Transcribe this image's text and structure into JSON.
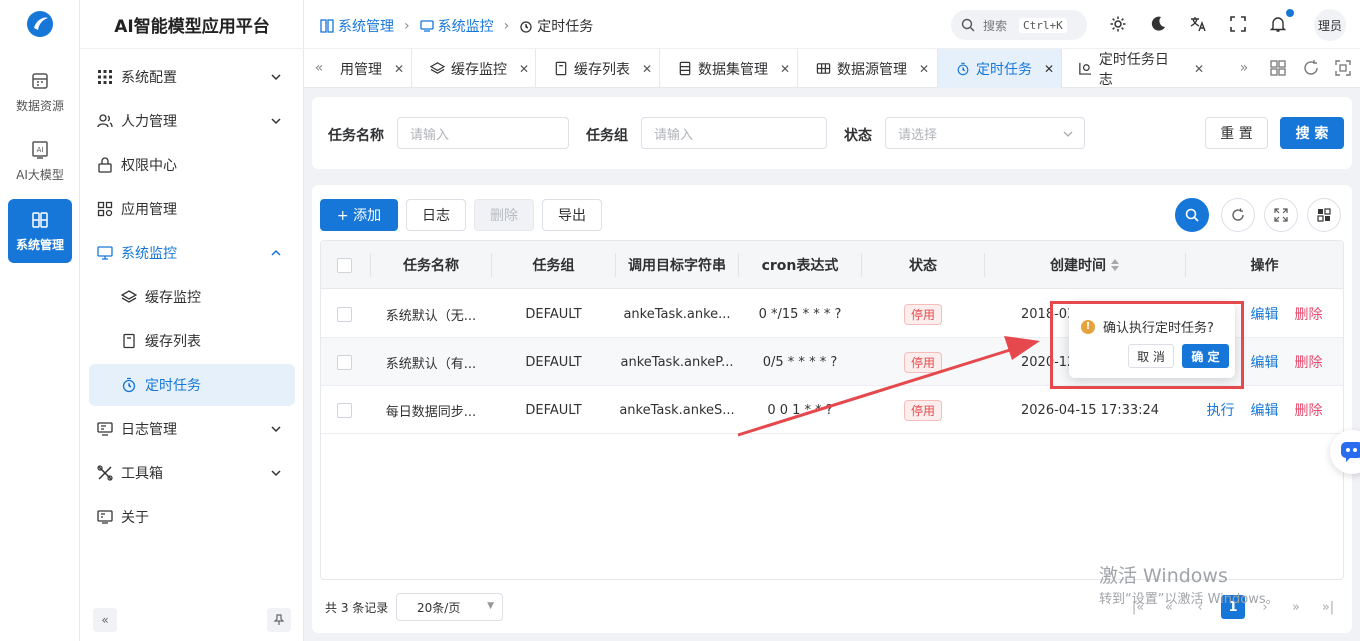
{
  "rail": {
    "items": [
      {
        "label": "数据资源",
        "icon": "database-icon"
      },
      {
        "label": "AI大模型",
        "icon": "ai-icon"
      },
      {
        "label": "系统管理",
        "icon": "system-icon",
        "active": true
      }
    ]
  },
  "app": {
    "title": "AI智能模型应用平台"
  },
  "menu": {
    "items": [
      {
        "label": "系统配置"
      },
      {
        "label": "人力管理"
      },
      {
        "label": "权限中心"
      },
      {
        "label": "应用管理"
      },
      {
        "label": "系统监控"
      },
      {
        "label": "缓存监控"
      },
      {
        "label": "缓存列表"
      },
      {
        "label": "定时任务"
      },
      {
        "label": "日志管理"
      },
      {
        "label": "工具箱"
      },
      {
        "label": "关于"
      }
    ]
  },
  "breadcrumb": [
    "系统管理",
    "系统监控",
    "定时任务"
  ],
  "header": {
    "search_label": "搜索",
    "shortcut": "Ctrl+K",
    "avatar_text": "理员"
  },
  "tabs": [
    {
      "label": "用管理"
    },
    {
      "label": "缓存监控"
    },
    {
      "label": "缓存列表"
    },
    {
      "label": "数据集管理"
    },
    {
      "label": "数据源管理"
    },
    {
      "label": "定时任务",
      "active": true
    },
    {
      "label": "定时任务日志"
    }
  ],
  "filters": {
    "task_name_label": "任务名称",
    "task_name_placeholder": "请输入",
    "task_group_label": "任务组",
    "task_group_placeholder": "请输入",
    "status_label": "状态",
    "status_placeholder": "请选择",
    "reset_label": "重 置",
    "search_label": "搜 索"
  },
  "toolbar": {
    "add_label": "+ 添加",
    "log_label": "日志",
    "delete_label": "删除",
    "export_label": "导出"
  },
  "table": {
    "headers": [
      "任务名称",
      "任务组",
      "调用目标字符串",
      "cron表达式",
      "状态",
      "创建时间",
      "操作"
    ],
    "rows": [
      {
        "name": "系统默认（无...",
        "group": "DEFAULT",
        "target": "ankeTask.anke...",
        "cron": "0 */15 * * * ?",
        "status": "停用",
        "created": "2018-03"
      },
      {
        "name": "系统默认（有...",
        "group": "DEFAULT",
        "target": "ankeTask.ankeP...",
        "cron": "0/5 * * * * ?",
        "status": "停用",
        "created": "2020-12"
      },
      {
        "name": "每日数据同步...",
        "group": "DEFAULT",
        "target": "ankeTask.ankeS...",
        "cron": "0 0 1 * * ?",
        "status": "停用",
        "created": "2026-04-15 17:33:24"
      }
    ],
    "actions": {
      "run": "执行",
      "edit": "编辑",
      "delete": "删除"
    }
  },
  "popconfirm": {
    "message": "确认执行定时任务?",
    "cancel": "取 消",
    "confirm": "确 定"
  },
  "pagination": {
    "total_text": "共 3 条记录",
    "page_size": "20条/页",
    "current_page": "1"
  },
  "watermark": {
    "line1": "激活 Windows",
    "line2": "转到“设置”以激活 Windows。"
  },
  "colors": {
    "primary": "#1677d9",
    "danger": "#e64a6d",
    "annotation": "#e5484d"
  }
}
